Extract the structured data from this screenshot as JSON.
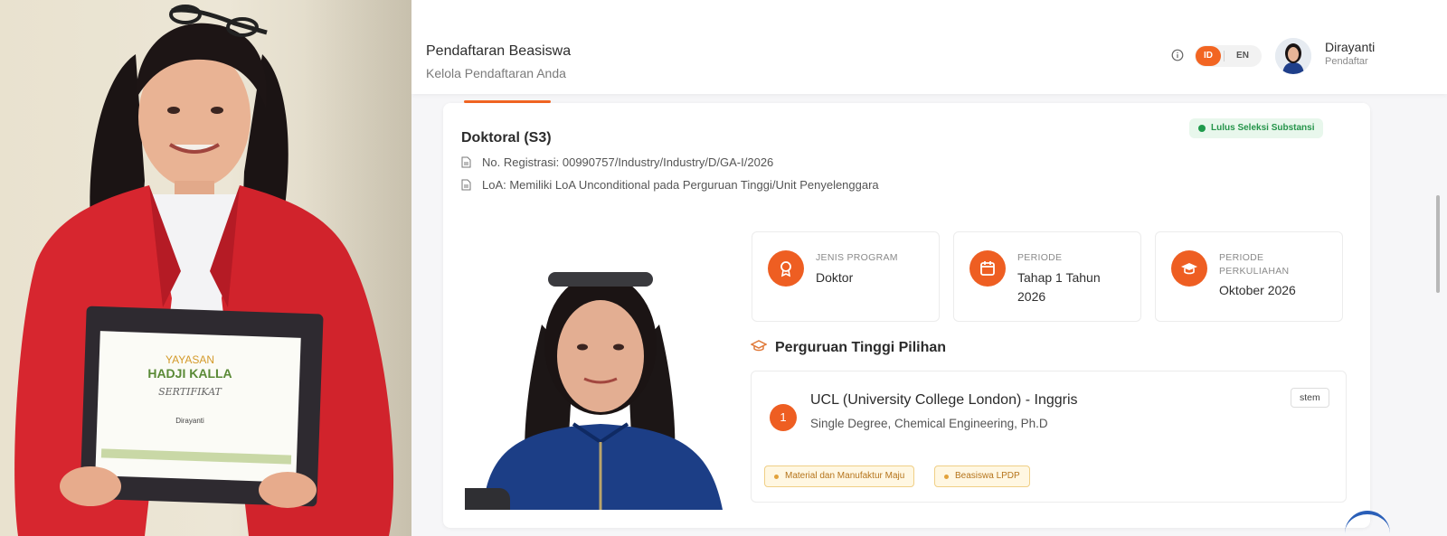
{
  "header": {
    "title": "Pendaftaran Beasiswa",
    "subtitle": "Kelola Pendaftaran Anda",
    "lang_active": "ID",
    "lang_other": "EN",
    "user_name": "Dirayanti",
    "user_role": "Pendaftar"
  },
  "application": {
    "degree": "Doktoral (S3)",
    "status": "Lulus Seleksi Substansi",
    "registration": "No. Registrasi: 00990757/Industry/Industry/D/GA-I/2026",
    "loa": "LoA: Memiliki LoA Unconditional pada Perguruan Tinggi/Unit Penyelenggara"
  },
  "info_cards": [
    {
      "label": "JENIS PROGRAM",
      "value": "Doktor",
      "icon": "award-icon"
    },
    {
      "label": "PERIODE",
      "value": "Tahap 1 Tahun 2026",
      "icon": "calendar-icon"
    },
    {
      "label": "PERIODE PERKULIAHAN",
      "value": "Oktober 2026",
      "icon": "graduation-cap-icon"
    }
  ],
  "universities_section": {
    "title": "Perguruan Tinggi Pilihan",
    "items": [
      {
        "rank": "1",
        "name": "UCL (University College London) - Inggris",
        "program": "Single Degree, Chemical Engineering, Ph.D",
        "tag": "stem",
        "pills": [
          "Material dan Manufaktur Maju",
          "Beasiswa LPDP"
        ]
      }
    ]
  },
  "photo_certificate": {
    "org_line1": "YAYASAN",
    "org_line2": "HADJI KALLA",
    "doc_title": "SERTIFIKAT",
    "recipient": "Dirayanti"
  },
  "colors": {
    "accent": "#f26522",
    "status_green": "#1f9a4c",
    "pill_bg": "#fff7e2",
    "blazer_red": "#d7262f"
  }
}
